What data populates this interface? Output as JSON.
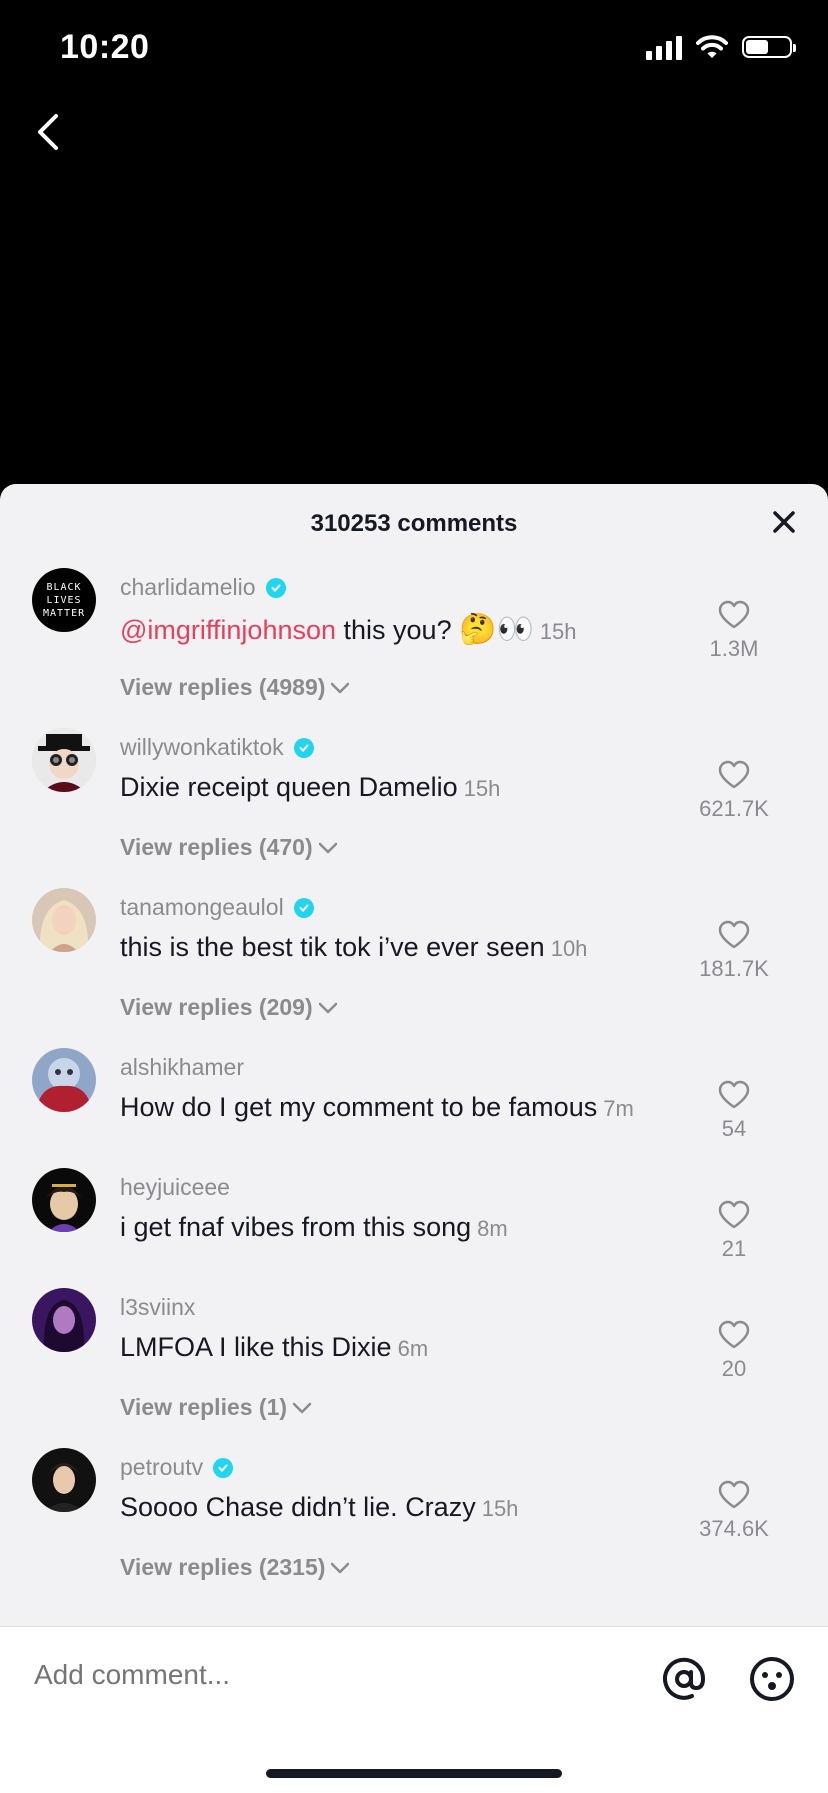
{
  "status_bar": {
    "time": "10:20"
  },
  "header": {
    "comments_count": "310253 comments"
  },
  "comments": [
    {
      "username": "charlidamelio",
      "verified": true,
      "mention": "@imgriffinjohnson",
      "text": " this you? ",
      "emoji": "🤔👀",
      "time": "15h",
      "likes": "1.3M",
      "replies": "View replies (4989)"
    },
    {
      "username": "willywonkatiktok",
      "verified": true,
      "text": "Dixie receipt queen Damelio",
      "time": "15h",
      "likes": "621.7K",
      "replies": "View replies (470)"
    },
    {
      "username": "tanamongeaulol",
      "verified": true,
      "text": "this is the best tik tok i’ve ever seen",
      "time": "10h",
      "likes": "181.7K",
      "replies": "View replies (209)"
    },
    {
      "username": "alshikhamer",
      "verified": false,
      "text": "How do I get my comment to be famous",
      "time": "7m",
      "likes": "54"
    },
    {
      "username": "heyjuiceee",
      "verified": false,
      "text": "i get fnaf vibes from this song",
      "time": "8m",
      "likes": "21"
    },
    {
      "username": "l3sviinx",
      "verified": false,
      "text": "LMFOA I like this Dixie",
      "time": "6m",
      "likes": "20",
      "replies": "View replies (1)"
    },
    {
      "username": "petroutv",
      "verified": true,
      "text": "Soooo Chase didn’t lie. Crazy",
      "time": "15h",
      "likes": "374.6K",
      "replies": "View replies (2315)"
    }
  ],
  "avatar_badges": {
    "blm": "BLACK LIVES MATTER"
  },
  "footer": {
    "placeholder": "Add comment..."
  },
  "colors": {
    "mention": "#e5415d",
    "verified": "#20d5ec",
    "text": "#161823",
    "muted": "#8a8b91"
  }
}
